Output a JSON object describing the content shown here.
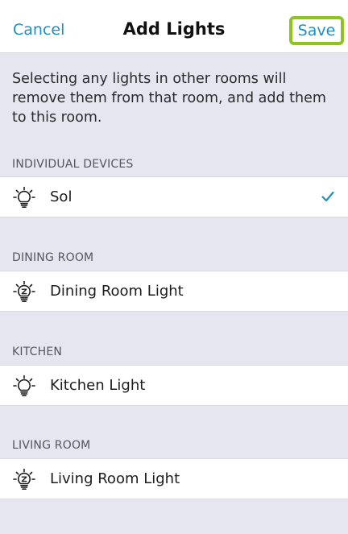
{
  "navbar": {
    "cancel_label": "Cancel",
    "title": "Add Lights",
    "save_label": "Save"
  },
  "info_text": "Selecting any lights in other rooms will remove them from that room, and add them to this room.",
  "sections": [
    {
      "header": "INDIVIDUAL DEVICES",
      "item": {
        "label": "Sol",
        "icon": "bulb-icon",
        "selected": true
      }
    },
    {
      "header": "DINING ROOM",
      "item": {
        "label": "Dining Room Light",
        "icon": "zigbee-bulb-icon",
        "selected": false
      }
    },
    {
      "header": "KITCHEN",
      "item": {
        "label": "Kitchen Light",
        "icon": "bulb-icon",
        "selected": false
      }
    },
    {
      "header": "LIVING ROOM",
      "item": {
        "label": "Living Room Light",
        "icon": "zigbee-bulb-icon",
        "selected": false
      }
    }
  ],
  "colors": {
    "accent": "#1a90c8",
    "highlight": "#8fc31f",
    "background": "#e6e6f0"
  }
}
